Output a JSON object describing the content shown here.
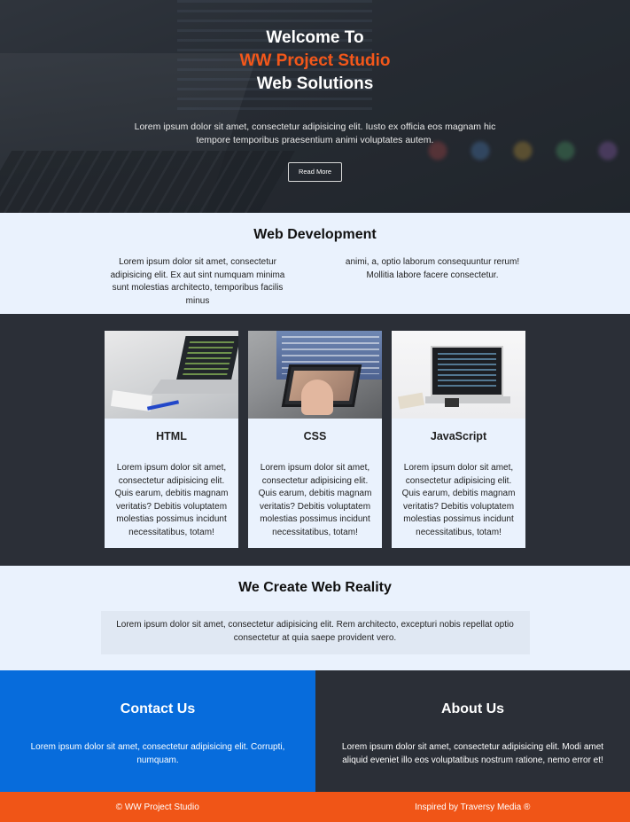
{
  "hero": {
    "line1": "Welcome To",
    "brand": "WW Project Studio",
    "line3": "Web Solutions",
    "lead": "Lorem ipsum dolor sit amet, consectetur adipisicing elit. Iusto ex officia eos magnam hic tempore temporibus praesentium animi voluptates autem.",
    "button": "Read More"
  },
  "webdev": {
    "title": "Web Development",
    "col1": "Lorem ipsum dolor sit amet, consectetur adipisicing elit. Ex aut sint numquam minima sunt molestias architecto, temporibus facilis minus",
    "col2": "animi, a, optio laborum consequuntur rerum! Mollitia labore facere consectetur."
  },
  "cards": [
    {
      "title": "HTML",
      "text": "Lorem ipsum dolor sit amet, consectetur adipisicing elit. Quis earum, debitis magnam veritatis? Debitis voluptatem molestias possimus incidunt necessitatibus, totam!"
    },
    {
      "title": "CSS",
      "text": "Lorem ipsum dolor sit amet, consectetur adipisicing elit. Quis earum, debitis magnam veritatis? Debitis voluptatem molestias possimus incidunt necessitatibus, totam!"
    },
    {
      "title": "JavaScript",
      "text": "Lorem ipsum dolor sit amet, consectetur adipisicing elit. Quis earum, debitis magnam veritatis? Debitis voluptatem molestias possimus incidunt necessitatibus, totam!"
    }
  ],
  "reality": {
    "title": "We Create Web Reality",
    "text": "Lorem ipsum dolor sit amet, consectetur adipisicing elit. Rem architecto, excepturi nobis repellat optio consectetur at quia saepe provident vero."
  },
  "contact": {
    "title": "Contact Us",
    "text": "Lorem ipsum dolor sit amet, consectetur adipisicing elit. Corrupti, numquam."
  },
  "about": {
    "title": "About Us",
    "text": "Lorem ipsum dolor sit amet, consectetur adipisicing elit. Modi amet aliquid eveniet illo eos voluptatibus nostrum ratione, nemo error et!"
  },
  "footer": {
    "copyright": "© WW Project Studio",
    "credit": "Inspired by Traversy Media ®"
  },
  "colors": {
    "accent": "#f3571a",
    "blue": "#076cdc",
    "dark": "#2b2f37",
    "light": "#eaf2fd"
  }
}
